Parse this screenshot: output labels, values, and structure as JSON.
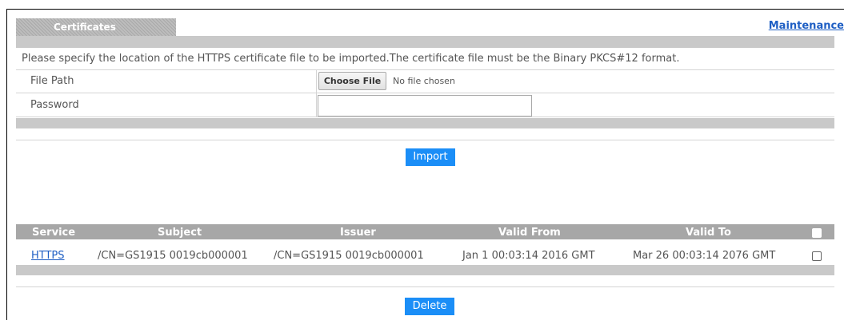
{
  "header": {
    "tab_label": "Certificates",
    "maintenance_link": "Maintenance"
  },
  "form": {
    "intro": "Please specify the location of the HTTPS certificate file to be imported.The certificate file must be the Binary PKCS#12 format.",
    "file_path_label": "File Path",
    "choose_file_label": "Choose File",
    "no_file_text": "No file chosen",
    "password_label": "Password",
    "password_value": "",
    "import_label": "Import"
  },
  "table": {
    "columns": [
      "Service",
      "Subject",
      "Issuer",
      "Valid From",
      "Valid To"
    ],
    "rows": [
      {
        "service": "HTTPS",
        "subject": "/CN=GS1915 0019cb000001",
        "issuer": "/CN=GS1915 0019cb000001",
        "valid_from": "Jan 1 00:03:14 2016 GMT",
        "valid_to": "Mar 26 00:03:14 2076 GMT"
      }
    ],
    "delete_label": "Delete"
  },
  "colors": {
    "accent": "#1b8ef7",
    "link": "#1f5fc4",
    "header_gray": "#a7a7a7"
  }
}
